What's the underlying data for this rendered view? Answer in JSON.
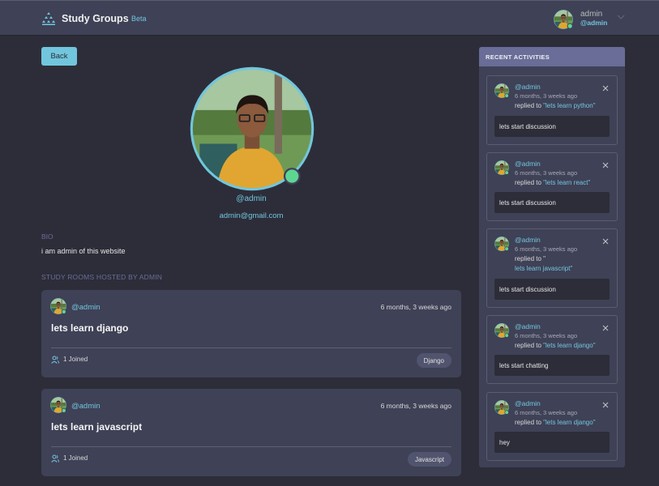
{
  "header": {
    "brand": "Study Groups",
    "beta": "Beta",
    "user_name": "admin",
    "user_handle": "@admin",
    "icons": [
      "logo-icon",
      "chevron-down-icon"
    ]
  },
  "back_label": "Back",
  "profile": {
    "handle": "@admin",
    "email": "admin@gmail.com",
    "bio_label": "BIO",
    "bio": "i am admin of this website",
    "online": true
  },
  "rooms_heading": "STUDY ROOMS HOSTED BY ADMIN",
  "rooms": [
    {
      "host": "@admin",
      "time": "6 months, 3 weeks ago",
      "title": "lets learn django",
      "joined": "1 Joined",
      "topic": "Django"
    },
    {
      "host": "@admin",
      "time": "6 months, 3 weeks ago",
      "title": "lets learn javascript",
      "joined": "1 Joined",
      "topic": "Javascript"
    }
  ],
  "activities": {
    "heading": "RECENT ACTIVITIES",
    "items": [
      {
        "host": "@admin",
        "time": "6 months, 3 weeks ago",
        "replied": "replied to",
        "room": "\"lets learn python\"",
        "message": "lets start discussion"
      },
      {
        "host": "@admin",
        "time": "6 months, 3 weeks ago",
        "replied": "replied to",
        "room": "\"lets learn react\"",
        "message": "lets start discussion"
      },
      {
        "host": "@admin",
        "time": "6 months, 3 weeks ago",
        "replied": "replied to \"",
        "room": "lets learn javascript\"",
        "message": "lets start discussion"
      },
      {
        "host": "@admin",
        "time": "6 months, 3 weeks ago",
        "replied": "replied to",
        "room": "\"lets learn django\"",
        "message": "lets start chatting"
      },
      {
        "host": "@admin",
        "time": "6 months, 3 weeks ago",
        "replied": "replied to",
        "room": "\"lets learn django\"",
        "message": "hey"
      }
    ]
  },
  "colors": {
    "background": "#2d2d39",
    "panel": "#3f4156",
    "accent": "#71c6dd",
    "muted": "#696d97",
    "online": "#5dd693"
  }
}
